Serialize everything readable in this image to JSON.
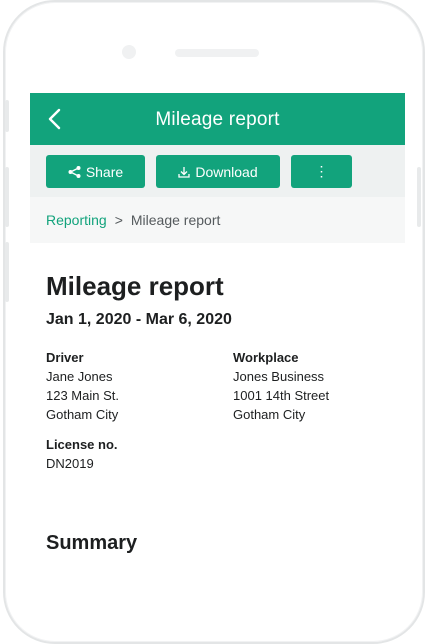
{
  "appbar": {
    "title": "Mileage report"
  },
  "toolbar": {
    "share_label": "Share",
    "download_label": "Download",
    "more_label": "⋮"
  },
  "breadcrumb": {
    "parent": "Reporting",
    "separator": ">",
    "current": "Mileage report"
  },
  "report": {
    "title": "Mileage report",
    "date_range": "Jan 1, 2020 - Mar 6, 2020",
    "driver": {
      "label": "Driver",
      "name": "Jane Jones",
      "street": "123 Main St.",
      "city": "Gotham City"
    },
    "workplace": {
      "label": "Workplace",
      "name": "Jones Business",
      "street": "1001 14th Street",
      "city": "Gotham City"
    },
    "license": {
      "label": "License no.",
      "value": "DN2019"
    },
    "summary_heading": "Summary"
  },
  "colors": {
    "accent": "#12a37c",
    "toolbar_bg": "#eef1f1",
    "breadcrumb_bg": "#f6f7f7",
    "text": "#1d1f20"
  },
  "icons": {
    "back": "chevron-left-icon",
    "share": "share-icon",
    "download": "download-icon",
    "more": "more-vertical-icon"
  }
}
